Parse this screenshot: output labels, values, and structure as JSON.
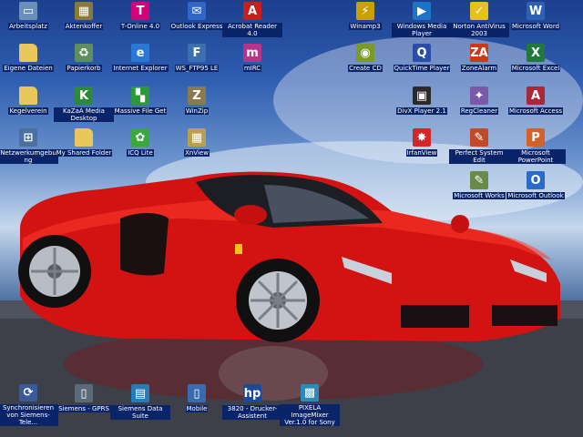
{
  "desktop": {
    "icons": [
      {
        "id": "arbeitsplatz",
        "label": "Arbeitsplatz",
        "icon": "my-computer-icon",
        "glyph": "▭",
        "color": "#6a8fb8"
      },
      {
        "id": "aktenkoffer",
        "label": "Aktenkoffer",
        "icon": "briefcase-icon",
        "glyph": "▦",
        "color": "#8a7a3a"
      },
      {
        "id": "t-online",
        "label": "T-Online 4.0",
        "icon": "t-online-icon",
        "glyph": "T",
        "color": "#d6007a"
      },
      {
        "id": "outlook-express",
        "label": "Outlook Express",
        "icon": "outlook-express-icon",
        "glyph": "✉",
        "color": "#2f66c8"
      },
      {
        "id": "acrobat-reader",
        "label": "Acrobat Reader 4.0",
        "icon": "acrobat-reader-icon",
        "glyph": "A",
        "color": "#c81e1e"
      },
      {
        "id": "winamp",
        "label": "Winamp3",
        "icon": "winamp-icon",
        "glyph": "⚡",
        "color": "#c8a000"
      },
      {
        "id": "windows-media-player",
        "label": "Windows Media Player",
        "icon": "media-player-icon",
        "glyph": "▶",
        "color": "#1d73c4"
      },
      {
        "id": "norton-antivirus",
        "label": "Norton AntiVirus 2003",
        "icon": "norton-antivirus-icon",
        "glyph": "✓",
        "color": "#e5c21a"
      },
      {
        "id": "microsoft-word",
        "label": "Microsoft Word",
        "icon": "word-icon",
        "glyph": "W",
        "color": "#2d5fb5"
      },
      {
        "id": "eigene-dateien",
        "label": "Eigene Dateien",
        "icon": "folder-icon",
        "glyph": "",
        "color": "#e8c85a"
      },
      {
        "id": "papierkorb",
        "label": "Papierkorb",
        "icon": "recycle-bin-icon",
        "glyph": "♻",
        "color": "#5e8f5e"
      },
      {
        "id": "internet-explorer",
        "label": "Internet Explorer",
        "icon": "internet-explorer-icon",
        "glyph": "e",
        "color": "#2a78d6"
      },
      {
        "id": "ws-ftp",
        "label": "WS_FTP95 LE",
        "icon": "ftp-icon",
        "glyph": "F",
        "color": "#3a6fb0"
      },
      {
        "id": "mirc",
        "label": "mIRC",
        "icon": "mirc-icon",
        "glyph": "m",
        "color": "#b8338a"
      },
      {
        "id": "create-cd",
        "label": "Create CD",
        "icon": "create-cd-icon",
        "glyph": "◉",
        "color": "#7a9a2a"
      },
      {
        "id": "quicktime",
        "label": "QuickTime Player",
        "icon": "quicktime-icon",
        "glyph": "Q",
        "color": "#2a4ea8"
      },
      {
        "id": "zonealarm",
        "label": "ZoneAlarm",
        "icon": "zonealarm-icon",
        "glyph": "ZA",
        "color": "#c83a18"
      },
      {
        "id": "microsoft-excel",
        "label": "Microsoft Excel",
        "icon": "excel-icon",
        "glyph": "X",
        "color": "#1f7a3a"
      },
      {
        "id": "kegelverein",
        "label": "Kegelverein",
        "icon": "folder-icon",
        "glyph": "",
        "color": "#e8c85a"
      },
      {
        "id": "kazaa",
        "label": "KaZaA Media Desktop",
        "icon": "kazaa-icon",
        "glyph": "K",
        "color": "#2d8a3a"
      },
      {
        "id": "massive-file-get",
        "label": "Massive File Get",
        "icon": "massive-file-get-icon",
        "glyph": "▚",
        "color": "#2a9a3a"
      },
      {
        "id": "winzip",
        "label": "WinZip",
        "icon": "winzip-icon",
        "glyph": "Z",
        "color": "#8a7a50"
      },
      {
        "id": "divx-player",
        "label": "DivX Player 2.1",
        "icon": "divx-icon",
        "glyph": "▣",
        "color": "#2a2a2a"
      },
      {
        "id": "regcleaner",
        "label": "RegCleaner",
        "icon": "regcleaner-icon",
        "glyph": "✦",
        "color": "#7a5aa8"
      },
      {
        "id": "microsoft-access",
        "label": "Microsoft Access",
        "icon": "access-icon",
        "glyph": "A",
        "color": "#a8283a"
      },
      {
        "id": "netzwerkumgebung",
        "label": "Netzwerkumgebung",
        "icon": "network-icon",
        "glyph": "⊞",
        "color": "#4a6fa0"
      },
      {
        "id": "my-shared-folder",
        "label": "My Shared Folder",
        "icon": "shared-folder-icon",
        "glyph": "",
        "color": "#e8c85a"
      },
      {
        "id": "icq-lite",
        "label": "ICQ Lite",
        "icon": "icq-icon",
        "glyph": "✿",
        "color": "#3aa83a"
      },
      {
        "id": "xnview",
        "label": "XnView",
        "icon": "xnview-icon",
        "glyph": "▦",
        "color": "#b8a050"
      },
      {
        "id": "irfanview",
        "label": "IrfanView",
        "icon": "irfanview-icon",
        "glyph": "✸",
        "color": "#d02828"
      },
      {
        "id": "perfect-system-edit",
        "label": "Perfect System Edit",
        "icon": "system-edit-icon",
        "glyph": "✎",
        "color": "#c04a2a"
      },
      {
        "id": "microsoft-powerpoint",
        "label": "Microsoft PowerPoint",
        "icon": "powerpoint-icon",
        "glyph": "P",
        "color": "#d2612a"
      },
      {
        "id": "microsoft-works",
        "label": "Microsoft Works",
        "icon": "works-icon",
        "glyph": "✎",
        "color": "#6a8a4a"
      },
      {
        "id": "microsoft-outlook",
        "label": "Microsoft Outlook",
        "icon": "outlook-icon",
        "glyph": "O",
        "color": "#2a6ac8"
      },
      {
        "id": "synchronisieren",
        "label": "Synchronisieren von Siemens-Tele...",
        "icon": "sync-icon",
        "glyph": "⟳",
        "color": "#3a5a9a"
      },
      {
        "id": "siemens-gprs",
        "label": "Siemens - GPRS",
        "icon": "phone-icon",
        "glyph": "▯",
        "color": "#5a6a7a"
      },
      {
        "id": "siemens-data-suite",
        "label": "Siemens Data Suite",
        "icon": "data-suite-icon",
        "glyph": "▤",
        "color": "#2a7ab8"
      },
      {
        "id": "mobile",
        "label": "Mobile",
        "icon": "mobile-icon",
        "glyph": "▯",
        "color": "#3a6ab0"
      },
      {
        "id": "drucker-assistent",
        "label": "3820 - Drucker-Assistent",
        "icon": "printer-icon",
        "glyph": "hp",
        "color": "#1a4a9a"
      },
      {
        "id": "pixela",
        "label": "PIXELA ImageMixer Ver.1.0 for Sony",
        "icon": "imagemixer-icon",
        "glyph": "▩",
        "color": "#2a8ab8"
      }
    ]
  }
}
